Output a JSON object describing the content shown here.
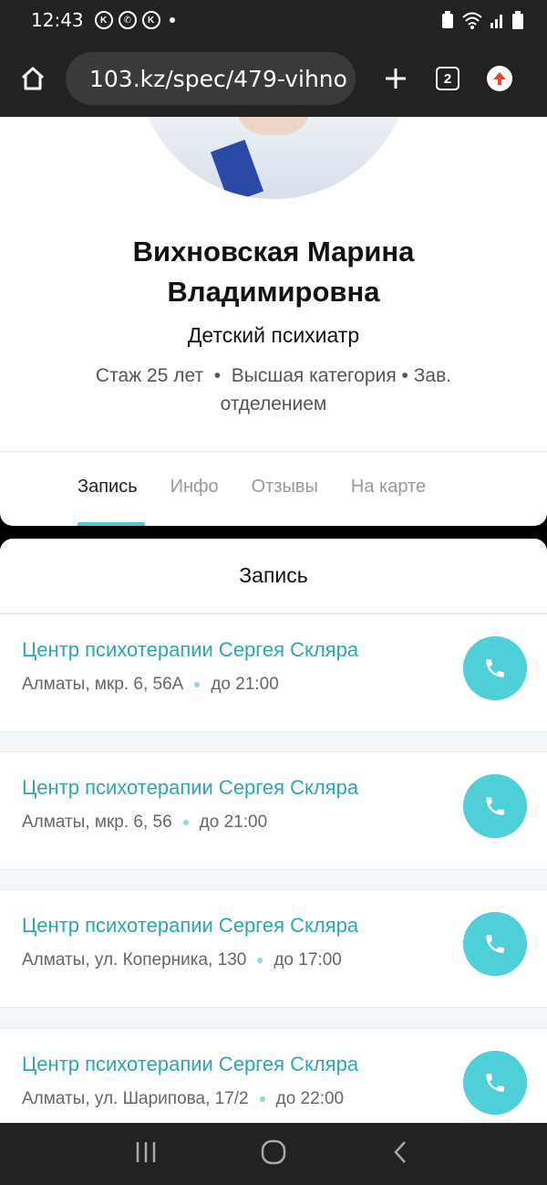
{
  "status_bar": {
    "time": "12:43"
  },
  "toolbar": {
    "url": "103.kz/spec/479-vihno",
    "tabs_count": "2"
  },
  "profile": {
    "name_line1": "Вихновская Марина",
    "name_line2": "Владимировна",
    "specialty": "Детский психиатр",
    "experience": "Стаж 25 лет",
    "category": "Высшая категория",
    "position": "Зав. отделением",
    "tabs": [
      "Запись",
      "Инфо",
      "Отзывы",
      "На карте"
    ],
    "active_tab": "Запись"
  },
  "booking": {
    "title": "Запись",
    "clinics": [
      {
        "name": "Центр психотерапии Сергея Скляра",
        "address": "Алматы, мкр. 6, 56А",
        "hours": "до 21:00"
      },
      {
        "name": "Центр психотерапии Сергея Скляра",
        "address": "Алматы, мкр. 6, 56",
        "hours": "до 21:00"
      },
      {
        "name": "Центр психотерапии Сергея Скляра",
        "address": "Алматы, ул. Коперника, 130",
        "hours": "до 17:00"
      },
      {
        "name": "Центр психотерапии Сергея Скляра",
        "address": "Алматы, ул. Шарипова, 17/2",
        "hours": "до 22:00"
      }
    ]
  },
  "colors": {
    "accent": "#4fcfd8",
    "link": "#2aa6b4"
  }
}
